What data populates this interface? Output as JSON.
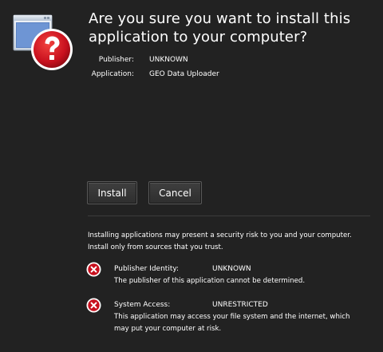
{
  "dialog": {
    "heading": "Are you sure you want to install this application to your computer?",
    "publisher_label": "Publisher:",
    "publisher_value": "UNKNOWN",
    "application_label": "Application:",
    "application_value": "GEO Data Uploader",
    "icon": "application-question-icon"
  },
  "buttons": {
    "install_label": "Install",
    "cancel_label": "Cancel"
  },
  "warning": {
    "text": "Installing applications may present a security risk to you and your computer. Install only from sources that you trust."
  },
  "risks": [
    {
      "icon": "error-x-icon",
      "label": "Publisher Identity:",
      "value": "UNKNOWN",
      "description": "The publisher of this application cannot be determined."
    },
    {
      "icon": "error-x-icon",
      "label": "System Access:",
      "value": "UNRESTRICTED",
      "description": "This application may access your file system and the internet, which may put your computer at risk."
    }
  ],
  "colors": {
    "background": "#222222",
    "text": "#ffffff",
    "question_badge": "#c8101e",
    "risk_icon": "#c8101e"
  }
}
